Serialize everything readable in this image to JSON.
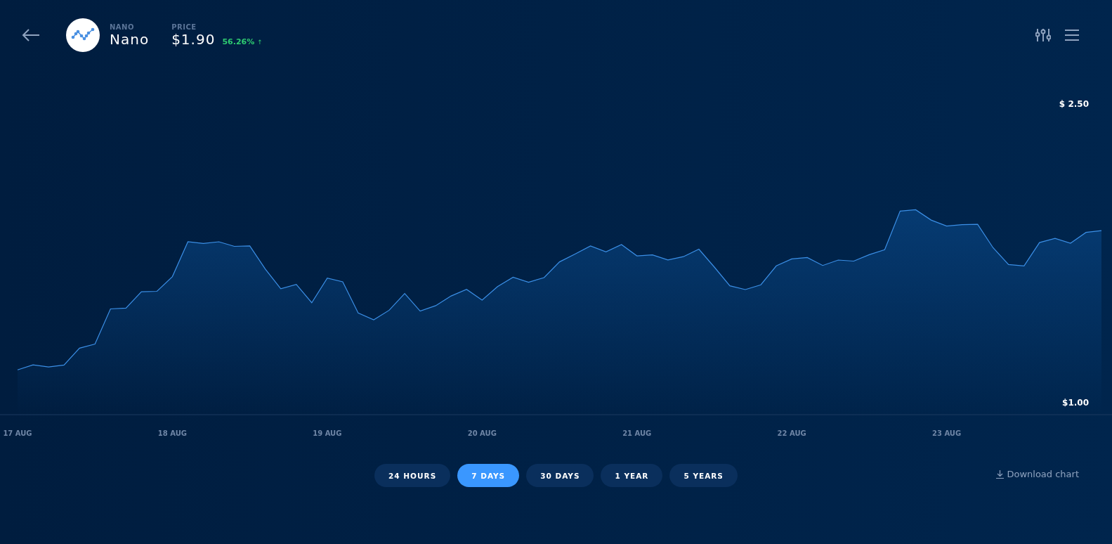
{
  "header": {
    "coin_symbol": "NANO",
    "coin_name": "Nano",
    "price_label": "PRICE",
    "price": "$1.90",
    "change": "56.26%",
    "change_arrow": "↑"
  },
  "chart": {
    "chart_data": {
      "type": "area",
      "ylim": [
        1.0,
        2.5
      ],
      "yticks": [
        {
          "value": 2.5,
          "label": "$ 2.50"
        },
        {
          "value": 1.0,
          "label": "$1.00"
        }
      ],
      "categories": [
        "17 AUG",
        null,
        null,
        null,
        null,
        null,
        null,
        null,
        null,
        null,
        "18 AUG",
        null,
        null,
        null,
        null,
        null,
        null,
        null,
        null,
        null,
        "19 AUG",
        null,
        null,
        null,
        null,
        null,
        null,
        null,
        null,
        null,
        "20 AUG",
        null,
        null,
        null,
        null,
        null,
        null,
        null,
        null,
        null,
        "21 AUG",
        null,
        null,
        null,
        null,
        null,
        null,
        null,
        null,
        null,
        "22 AUG",
        null,
        null,
        null,
        null,
        null,
        null,
        null,
        null,
        null,
        "23 AUG",
        null,
        null,
        null,
        null,
        null,
        null,
        null,
        null,
        null,
        null
      ],
      "series": [
        {
          "color": "#3b8fe6",
          "values": [
            1.16,
            1.185,
            1.174,
            1.184,
            1.269,
            1.289,
            1.466,
            1.47,
            1.552,
            1.554,
            1.628,
            1.803,
            1.795,
            1.803,
            1.78,
            1.782,
            1.666,
            1.567,
            1.589,
            1.497,
            1.621,
            1.602,
            1.445,
            1.411,
            1.459,
            1.543,
            1.455,
            1.482,
            1.531,
            1.564,
            1.51,
            1.578,
            1.625,
            1.6,
            1.623,
            1.702,
            1.741,
            1.782,
            1.752,
            1.789,
            1.732,
            1.737,
            1.712,
            1.728,
            1.766,
            1.676,
            1.582,
            1.563,
            1.587,
            1.682,
            1.717,
            1.724,
            1.684,
            1.711,
            1.706,
            1.738,
            1.763,
            1.957,
            1.964,
            1.912,
            1.882,
            1.889,
            1.891,
            1.773,
            1.689,
            1.682,
            1.799,
            1.82,
            1.796,
            1.85,
            1.859
          ]
        }
      ]
    }
  },
  "ranges": [
    {
      "label": "24 HOURS",
      "selected": false
    },
    {
      "label": "7 DAYS",
      "selected": true
    },
    {
      "label": "30 DAYS",
      "selected": false
    },
    {
      "label": "1 YEAR",
      "selected": false
    },
    {
      "label": "5 YEARS",
      "selected": false
    }
  ],
  "download": {
    "label": "Download chart"
  }
}
